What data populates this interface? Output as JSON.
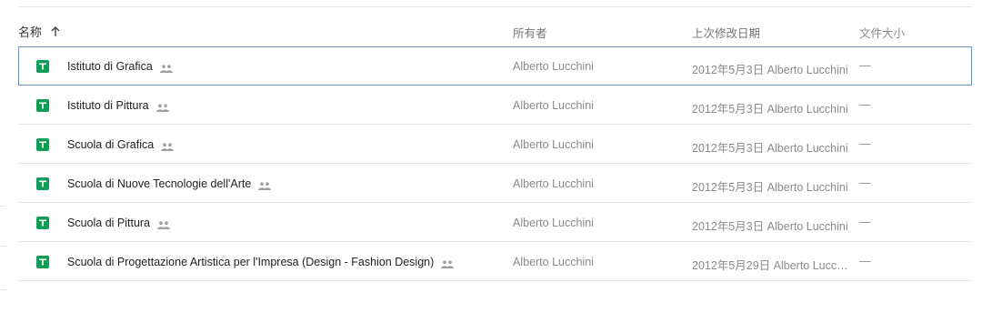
{
  "header": {
    "name_label": "名称",
    "owner_label": "所有者",
    "modified_label": "上次修改日期",
    "size_label": "文件大小",
    "sort_icon": "arrow-up-icon"
  },
  "rows": [
    {
      "name": "Istituto di Grafica",
      "owner": "Alberto Lucchini",
      "modified": "2012年5月3日 Alberto Lucchini",
      "size": "—",
      "icon": "google-sheets-icon",
      "shared_icon": "shared-people-icon",
      "selected": true
    },
    {
      "name": "Istituto di Pittura",
      "owner": "Alberto Lucchini",
      "modified": "2012年5月3日 Alberto Lucchini",
      "size": "—",
      "icon": "google-sheets-icon",
      "shared_icon": "shared-people-icon",
      "selected": false
    },
    {
      "name": "Scuola di Grafica",
      "owner": "Alberto Lucchini",
      "modified": "2012年5月3日 Alberto Lucchini",
      "size": "—",
      "icon": "google-sheets-icon",
      "shared_icon": "shared-people-icon",
      "selected": false
    },
    {
      "name": "Scuola di Nuove Tecnologie dell'Arte",
      "owner": "Alberto Lucchini",
      "modified": "2012年5月3日 Alberto Lucchini",
      "size": "—",
      "icon": "google-sheets-icon",
      "shared_icon": "shared-people-icon",
      "selected": false
    },
    {
      "name": "Scuola di Pittura",
      "owner": "Alberto Lucchini",
      "modified": "2012年5月3日 Alberto Lucchini",
      "size": "—",
      "icon": "google-sheets-icon",
      "shared_icon": "shared-people-icon",
      "selected": false
    },
    {
      "name": "Scuola di Progettazione Artistica per l'Impresa (Design - Fashion Design)",
      "owner": "Alberto Lucchini",
      "modified": "2012年5月29日 Alberto Lucchini...",
      "size": "—",
      "icon": "google-sheets-icon",
      "shared_icon": "shared-people-icon",
      "selected": false
    }
  ],
  "colors": {
    "sheets_green": "#0f9d58",
    "selection_border": "#6f93c7"
  }
}
